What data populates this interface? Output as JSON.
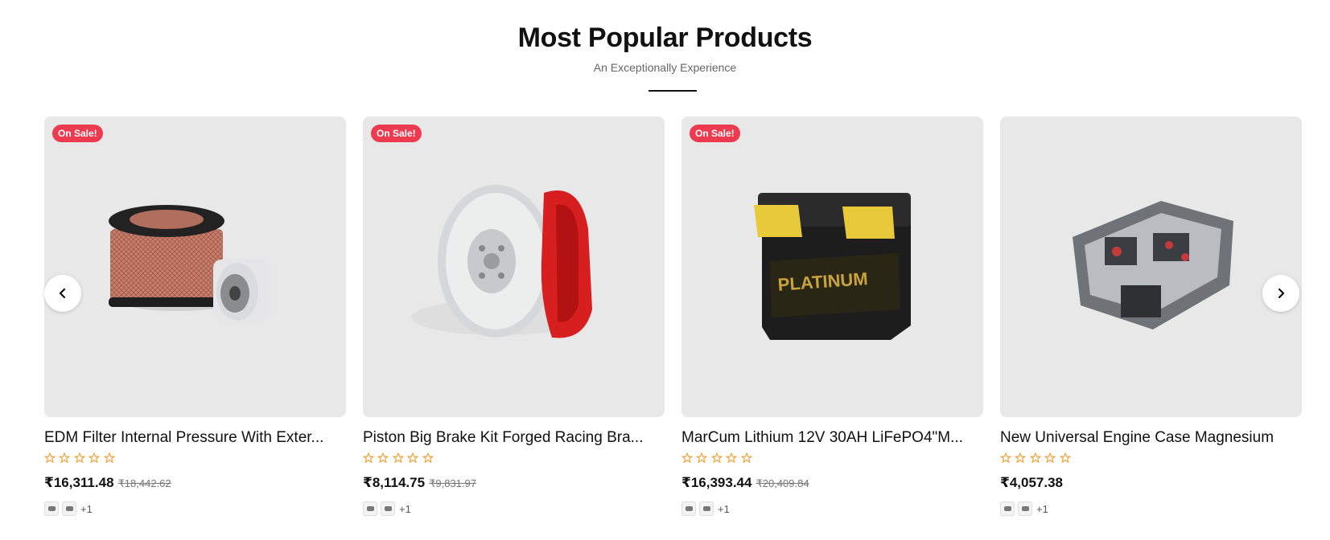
{
  "section": {
    "title": "Most Popular Products",
    "subtitle": "An Exceptionally Experience"
  },
  "colors": {
    "sale_badge": "#ee3a4e",
    "star": "#f0a23c",
    "card_bg": "#e9e8e8"
  },
  "carousel": {
    "prev_icon": "chevron-left-icon",
    "next_icon": "chevron-right-icon"
  },
  "products": [
    {
      "badge": "On Sale!",
      "name": "EDM Filter Internal Pressure With Exter...",
      "image": "air-filter-and-oil-filter",
      "rating": 0,
      "price": "₹16,311.48",
      "old_price": "₹18,442.62",
      "more_variants": "+1"
    },
    {
      "badge": "On Sale!",
      "name": "Piston Big Brake Kit Forged Racing Bra...",
      "image": "brake-disc-with-red-caliper",
      "rating": 0,
      "price": "₹8,114.75",
      "old_price": "₹9,831.97",
      "more_variants": "+1"
    },
    {
      "badge": "On Sale!",
      "name": "MarCum Lithium 12V 30AH LiFePO4\"M...",
      "image": "car-battery",
      "rating": 0,
      "price": "₹16,393.44",
      "old_price": "₹20,409.84",
      "more_variants": "+1"
    },
    {
      "badge": "",
      "name": "New Universal Engine Case Magnesium",
      "image": "engine-block",
      "rating": 0,
      "price": "₹4,057.38",
      "old_price": "",
      "more_variants": "+1"
    }
  ]
}
